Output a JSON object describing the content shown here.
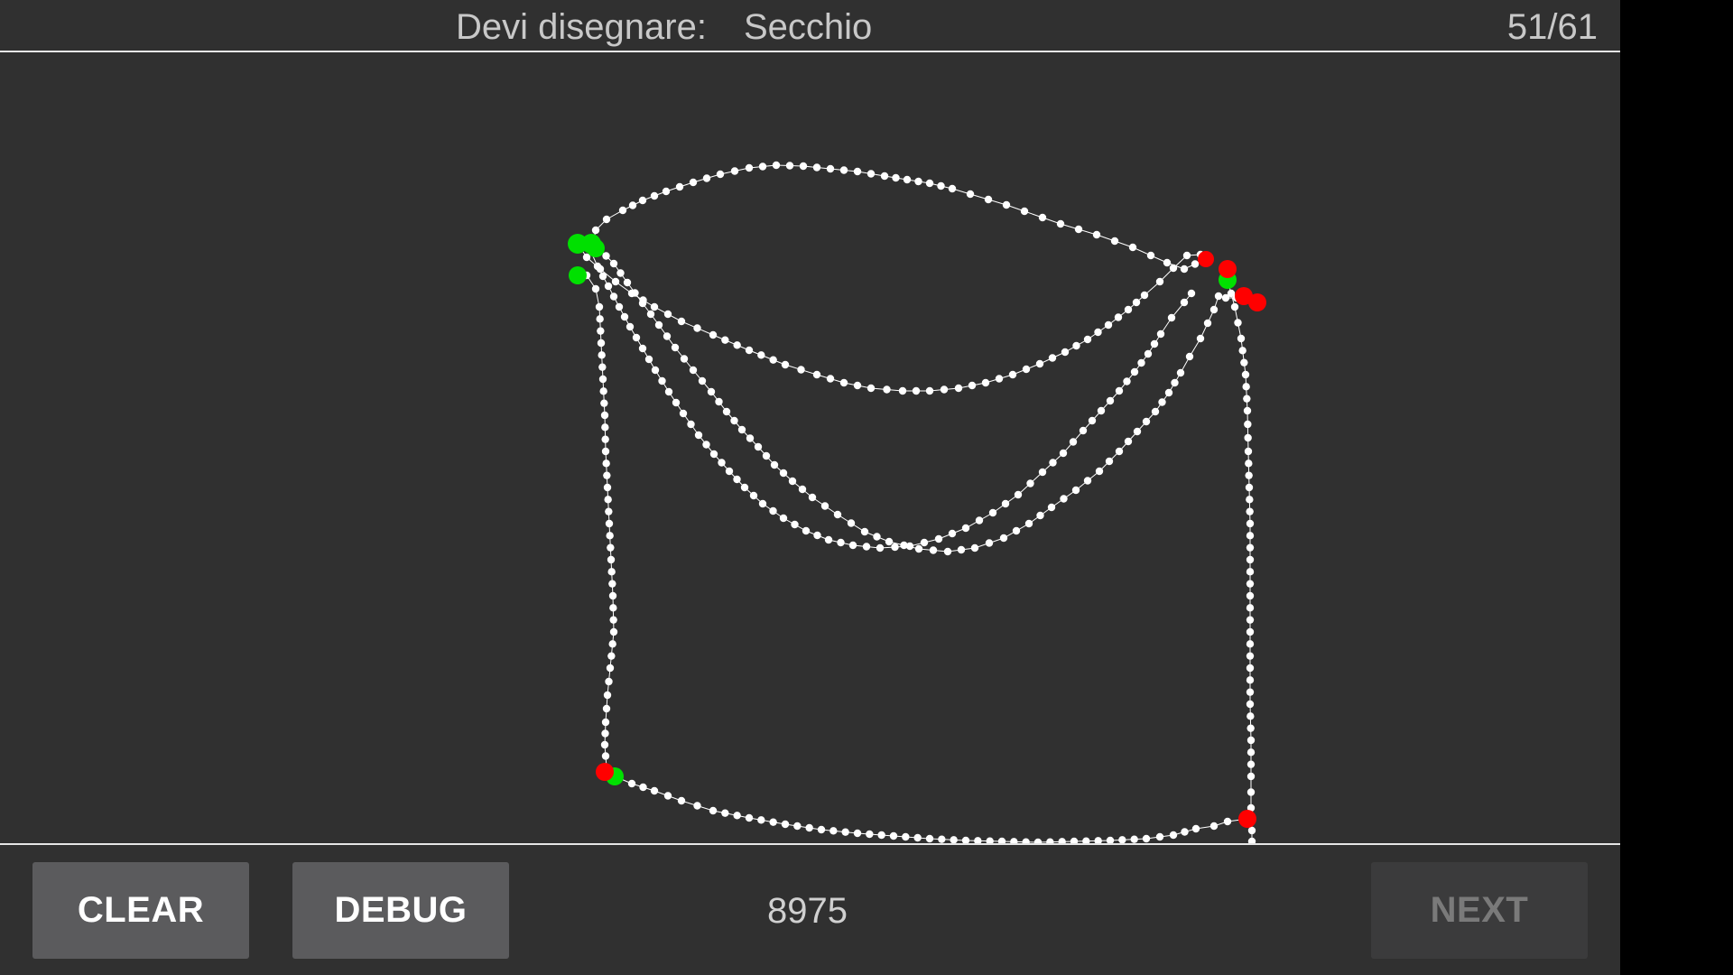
{
  "header": {
    "prompt_label": "Devi disegnare:",
    "prompt_word": "Secchio",
    "progress": "51/61"
  },
  "toolbar": {
    "clear_label": "CLEAR",
    "debug_label": "DEBUG",
    "score": "8975",
    "next_label": "NEXT"
  },
  "colors": {
    "background": "#303030",
    "stroke": "#ffffff",
    "stroke_start": "#00e000",
    "stroke_end": "#ff0000",
    "button": "#5b5b5d",
    "button_disabled": "#3b3b3c"
  }
}
